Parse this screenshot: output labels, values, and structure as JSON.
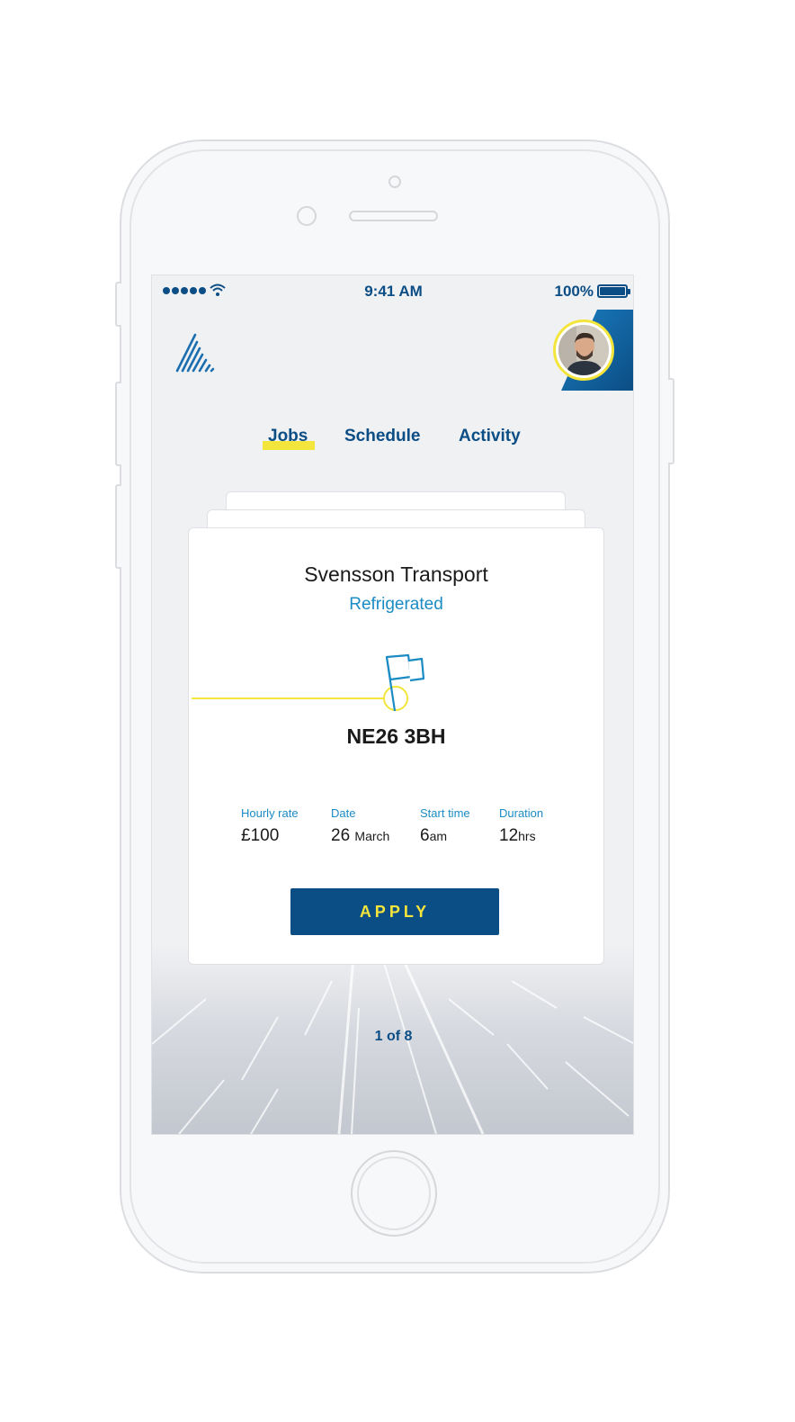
{
  "status_bar": {
    "time": "9:41 AM",
    "battery": "100%",
    "battery_level": 1.0,
    "signal_bars": 5
  },
  "profile": {
    "avatar_icon": "user-avatar"
  },
  "tabs": [
    {
      "label": "Jobs",
      "active": true
    },
    {
      "label": "Schedule",
      "active": false
    },
    {
      "label": "Activity",
      "active": false
    }
  ],
  "job": {
    "company": "Svensson Transport",
    "type": "Refrigerated",
    "postcode": "NE26 3BH",
    "details": {
      "hourly_rate": {
        "label": "Hourly rate",
        "value": "£100"
      },
      "date": {
        "label": "Date",
        "day": "26",
        "month": "March"
      },
      "start_time": {
        "label": "Start time",
        "value": "6",
        "unit": "am"
      },
      "duration": {
        "label": "Duration",
        "value": "12",
        "unit": "hrs"
      }
    },
    "apply_label": "APPLY"
  },
  "pager": "1 of 8",
  "colors": {
    "primary": "#0b4d85",
    "accent_yellow": "#f3e53b",
    "link_blue": "#1b8bc4",
    "background": "#f0f1f3"
  }
}
